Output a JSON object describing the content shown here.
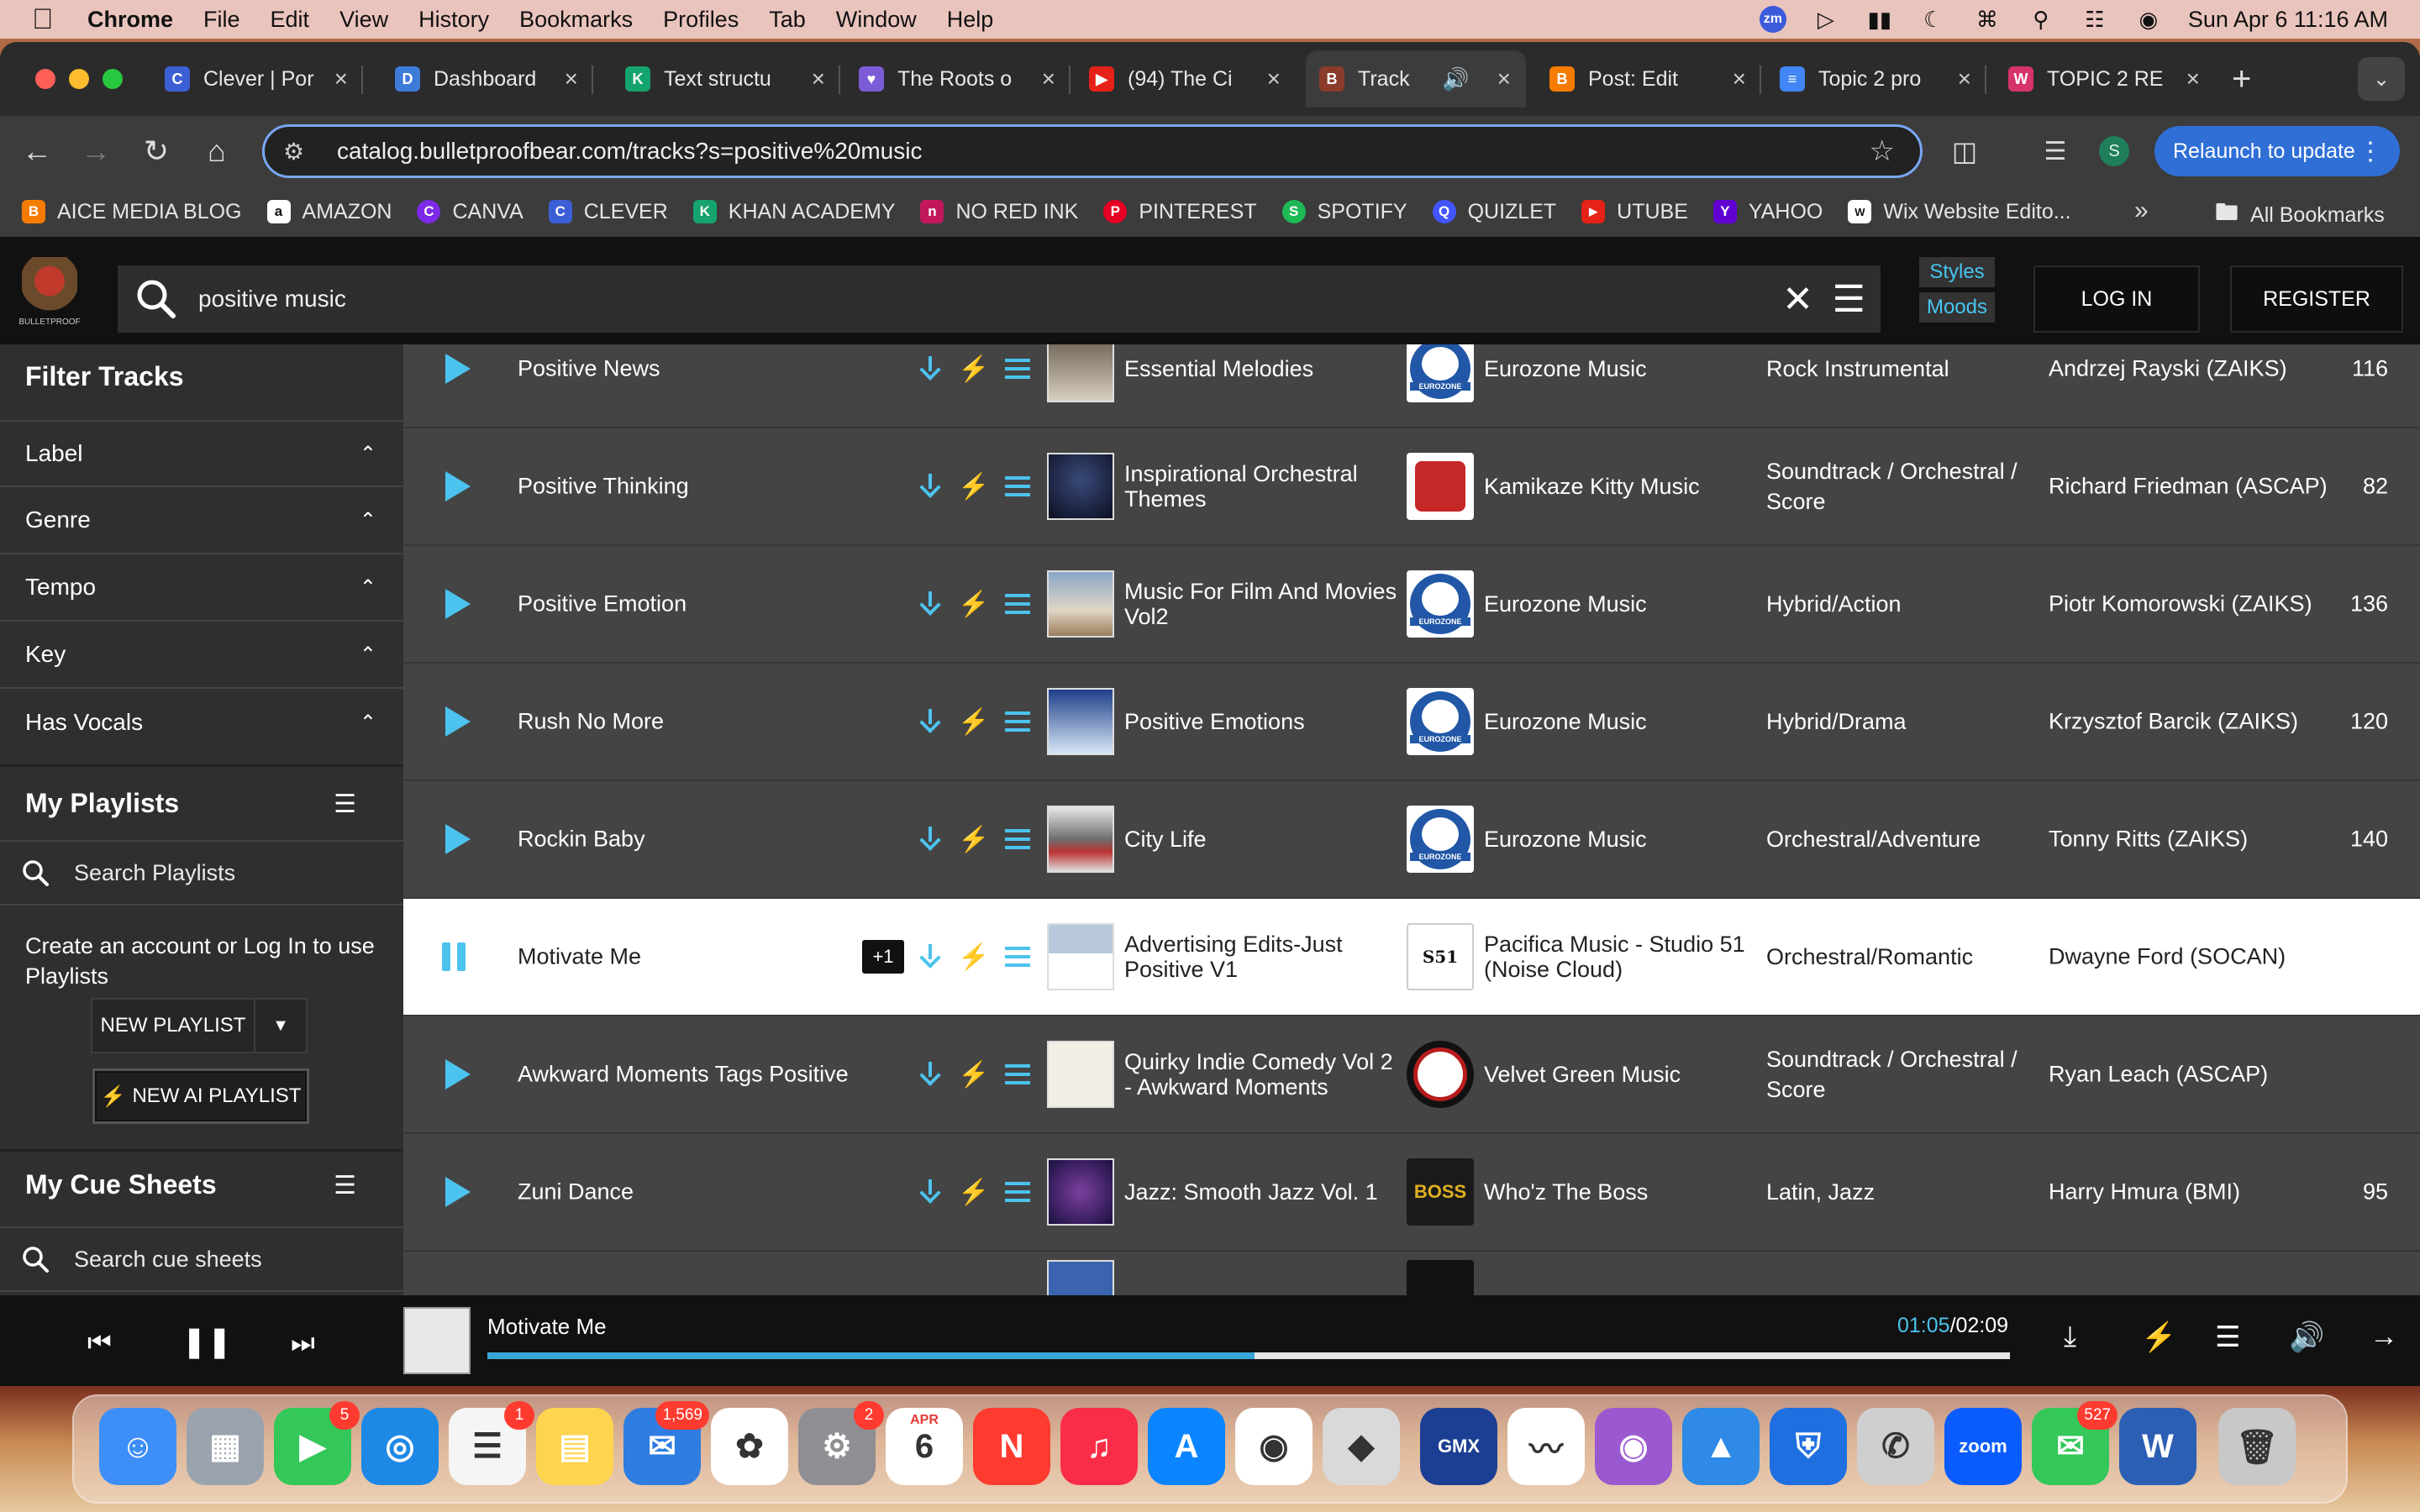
{
  "menubar": {
    "app": "Chrome",
    "items": [
      "File",
      "Edit",
      "View",
      "History",
      "Bookmarks",
      "Profiles",
      "Tab",
      "Window",
      "Help"
    ],
    "clock": "Sun Apr 6  11:16 AM",
    "zoom_badge": "zm"
  },
  "tabs": [
    {
      "title": "Clever | Por",
      "icon": "C",
      "color": "#3c5fd6"
    },
    {
      "title": "Dashboard",
      "icon": "D",
      "color": "#3d7bd9"
    },
    {
      "title": "Text structu",
      "icon": "K",
      "color": "#15a36e"
    },
    {
      "title": "The Roots o",
      "icon": "♥",
      "color": "#7b5cd6"
    },
    {
      "title": "(94) The Ci",
      "icon": "▶",
      "color": "#e62117"
    },
    {
      "title": "Track Li",
      "icon": "B",
      "color": "#8a3b2a"
    },
    {
      "title": "Post: Edit",
      "icon": "B",
      "color": "#f57c00"
    },
    {
      "title": "Topic 2 pro",
      "icon": "≡",
      "color": "#4285f4"
    },
    {
      "title": "TOPIC 2 RE",
      "icon": "W",
      "color": "#d6336c"
    }
  ],
  "omnibox": {
    "url": "catalog.bulletproofbear.com/tracks?s=positive%20music"
  },
  "relaunch_label": "Relaunch to update",
  "profile_initial": "S",
  "bookmarks": [
    {
      "label": "AICE MEDIA BLOG",
      "icon": "B",
      "color": "#f57c00"
    },
    {
      "label": "AMAZON",
      "icon": "a",
      "color": "#fff"
    },
    {
      "label": "CANVA",
      "icon": "C",
      "color": "#7d2ae8"
    },
    {
      "label": "CLEVER",
      "icon": "C",
      "color": "#3c5fd6"
    },
    {
      "label": "KHAN ACADEMY",
      "icon": "K",
      "color": "#15a36e"
    },
    {
      "label": "NO RED INK",
      "icon": "n",
      "color": "#c2185b"
    },
    {
      "label": "PINTEREST",
      "icon": "P",
      "color": "#e60023"
    },
    {
      "label": "SPOTIFY",
      "icon": "S",
      "color": "#1db954"
    },
    {
      "label": "QUIZLET",
      "icon": "Q",
      "color": "#4255ff"
    },
    {
      "label": "UTUBE",
      "icon": "▶",
      "color": "#e62117"
    },
    {
      "label": "YAHOO",
      "icon": "Y",
      "color": "#6001d2"
    },
    {
      "label": "Wix Website Edito...",
      "icon": "W",
      "color": "#222"
    }
  ],
  "bookmarks_all": "All Bookmarks",
  "site": {
    "search_query": "positive music",
    "styles_label": "Styles",
    "moods_label": "Moods",
    "login_label": "LOG IN",
    "register_label": "REGISTER",
    "logo_text": "BULLETPROOF"
  },
  "sidebar": {
    "filter_title": "Filter Tracks",
    "filters": [
      "Label",
      "Genre",
      "Tempo",
      "Key",
      "Has Vocals"
    ],
    "playlists_title": "My Playlists",
    "search_playlists": "Search Playlists",
    "note": "Create an account or Log In to use Playlists",
    "new_playlist": "NEW PLAYLIST",
    "new_ai_playlist": "NEW AI PLAYLIST",
    "cue_title": "My Cue Sheets",
    "search_cue": "Search cue sheets"
  },
  "tracks": [
    {
      "title": "Positive News",
      "album": "Essential Melodies",
      "label": "Eurozone Music",
      "genre": "Rock Instrumental",
      "composer": "Andrzej Rayski (ZAIKS)",
      "bpm": "116",
      "state": "play"
    },
    {
      "title": "Positive Thinking",
      "album": "Inspirational Orchestral Themes",
      "label": "Kamikaze Kitty Music",
      "genre": "Soundtrack / Orchestral / Score",
      "composer": "Richard Friedman (ASCAP)",
      "bpm": "82",
      "state": "play"
    },
    {
      "title": "Positive Emotion",
      "album": "Music For Film And Movies Vol2",
      "label": "Eurozone Music",
      "genre": "Hybrid/Action",
      "composer": "Piotr Komorowski (ZAIKS)",
      "bpm": "136",
      "state": "play"
    },
    {
      "title": "Rush No More",
      "album": "Positive Emotions",
      "label": "Eurozone Music",
      "genre": "Hybrid/Drama",
      "composer": "Krzysztof Barcik (ZAIKS)",
      "bpm": "120",
      "state": "play"
    },
    {
      "title": "Rockin Baby",
      "album": "City Life",
      "label": "Eurozone Music",
      "genre": "Orchestral/Adventure",
      "composer": "Tonny Ritts (ZAIKS)",
      "bpm": "140",
      "state": "play"
    },
    {
      "title": "Motivate Me",
      "album": "Advertising Edits-Just Positive V1",
      "label": "Pacifica Music - Studio 51 (Noise Cloud)",
      "genre": "Orchestral/Romantic",
      "composer": "Dwayne Ford (SOCAN)",
      "bpm": "",
      "state": "pause",
      "plus": "+1"
    },
    {
      "title": "Awkward Moments Tags Positive",
      "album": "Quirky Indie Comedy Vol 2 - Awkward Moments",
      "label": "Velvet Green Music",
      "genre": "Soundtrack / Orchestral / Score",
      "composer": "Ryan Leach (ASCAP)",
      "bpm": "",
      "state": "play"
    },
    {
      "title": "Zuni Dance",
      "album": "Jazz: Smooth Jazz Vol. 1",
      "label": "Who'z The Boss",
      "genre": "Latin, Jazz",
      "composer": "Harry Hmura (BMI)",
      "bpm": "95",
      "state": "play"
    }
  ],
  "player": {
    "title": "Motivate Me",
    "current": "01:05",
    "total": "/02:09",
    "progress_fraction": 0.504
  },
  "dock": [
    {
      "name": "finder",
      "color": "#3e8ef7",
      "glyph": "☺"
    },
    {
      "name": "launchpad",
      "color": "#9aa3ad",
      "glyph": "▦"
    },
    {
      "name": "facetime",
      "color": "#34c759",
      "glyph": "▶",
      "badge": "5"
    },
    {
      "name": "safari",
      "color": "#1e88e5",
      "glyph": "◎"
    },
    {
      "name": "reminders",
      "color": "#f5f5f5",
      "glyph": "☰",
      "badge": "1"
    },
    {
      "name": "notes",
      "color": "#ffd54f",
      "glyph": "▤"
    },
    {
      "name": "mail",
      "color": "#2f7de1",
      "glyph": "✉",
      "badge": "1,569"
    },
    {
      "name": "photos",
      "color": "#ffffff",
      "glyph": "✿"
    },
    {
      "name": "system-settings",
      "color": "#8e8e93",
      "glyph": "⚙",
      "badge": "2"
    },
    {
      "name": "calendar",
      "color": "#ffffff",
      "glyph": "6",
      "month": "APR"
    },
    {
      "name": "news",
      "color": "#ff3b30",
      "glyph": "N"
    },
    {
      "name": "music",
      "color": "#fa2d48",
      "glyph": "♫"
    },
    {
      "name": "app-store",
      "color": "#0a84ff",
      "glyph": "A"
    },
    {
      "name": "chrome",
      "color": "#ffffff",
      "glyph": "◉"
    },
    {
      "name": "roblox",
      "color": "#d9d9d9",
      "glyph": "◆"
    },
    {
      "name": "gmx",
      "color": "#1c3f94",
      "glyph": "GMX"
    },
    {
      "name": "freeform",
      "color": "#ffffff",
      "glyph": "〰"
    },
    {
      "name": "podcasts",
      "color": "#9b59d0",
      "glyph": "◉"
    },
    {
      "name": "keynote",
      "color": "#2e8ae6",
      "glyph": "▲"
    },
    {
      "name": "shield-app",
      "color": "#1f6fe0",
      "glyph": "⛨"
    },
    {
      "name": "whatsapp",
      "color": "#cfcfcf",
      "glyph": "✆"
    },
    {
      "name": "zoom",
      "color": "#0b5cff",
      "glyph": "zoom"
    },
    {
      "name": "messages",
      "color": "#34c759",
      "glyph": "✉",
      "badge": "527"
    },
    {
      "name": "word",
      "color": "#2b5fb3",
      "glyph": "W"
    },
    {
      "name": "trash",
      "color": "#c8c8c8",
      "glyph": "🗑"
    }
  ]
}
